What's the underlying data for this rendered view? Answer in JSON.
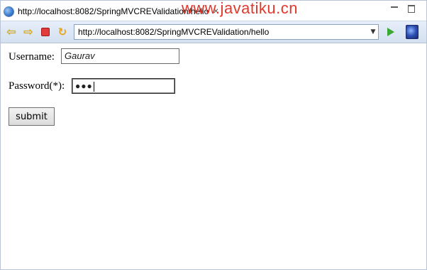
{
  "tab": {
    "title": "http://localhost:8082/SpringMVCREValidation/hello",
    "close_glyph": "✕"
  },
  "watermark": "www.javatiku.cn",
  "toolbar": {
    "url": "http://localhost:8082/SpringMVCREValidation/hello",
    "dropdown_glyph": "▼",
    "back_glyph": "⇦",
    "forward_glyph": "⇨",
    "refresh_glyph": "↻"
  },
  "form": {
    "username_label": "Username:",
    "username_value": "Gaurav",
    "password_label": "Password(*):",
    "password_value": "●●●",
    "submit_label": "submit"
  },
  "colors": {
    "watermark": "#e0382b",
    "go_button": "#3aa832",
    "stop_button": "#e23b3b"
  }
}
